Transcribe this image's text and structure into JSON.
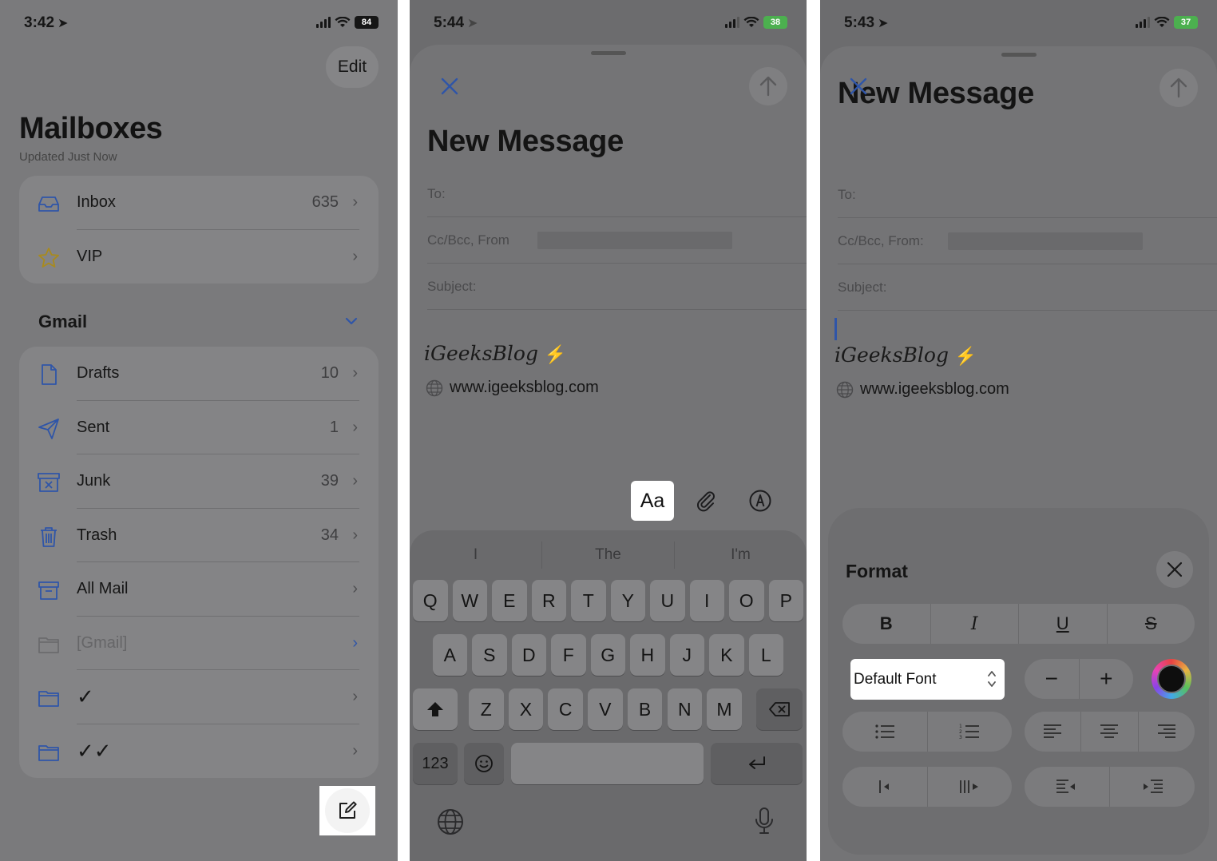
{
  "panel1": {
    "status": {
      "time": "3:42",
      "battery": "84",
      "battery_color": "#161616"
    },
    "edit_label": "Edit",
    "title": "Mailboxes",
    "subtitle": "Updated Just Now",
    "top_items": [
      {
        "label": "Inbox",
        "count": "635",
        "icon": "inbox-icon"
      },
      {
        "label": "VIP",
        "count": "",
        "icon": "star-icon"
      }
    ],
    "section": "Gmail",
    "gmail_items": [
      {
        "label": "Drafts",
        "count": "10",
        "icon": "document-icon"
      },
      {
        "label": "Sent",
        "count": "1",
        "icon": "paper-plane-icon"
      },
      {
        "label": "Junk",
        "count": "39",
        "icon": "junk-box-icon"
      },
      {
        "label": "Trash",
        "count": "34",
        "icon": "trash-icon"
      },
      {
        "label": "All Mail",
        "count": "",
        "icon": "archive-box-icon"
      },
      {
        "label": "[Gmail]",
        "count": "",
        "icon": "folder-icon"
      },
      {
        "label": "✓",
        "count": "",
        "icon": "folder-icon"
      },
      {
        "label": "✓✓",
        "count": "",
        "icon": "folder-icon"
      }
    ],
    "compose_icon": "compose-icon"
  },
  "panel2": {
    "status": {
      "time": "5:44",
      "battery": "38",
      "battery_color": "#4cb04f"
    },
    "title": "New Message",
    "to_label": "To:",
    "ccbcc_label": "Cc/Bcc, From",
    "subject_label": "Subject:",
    "signature": "iGeeksBlog",
    "url": "www.igeeksblog.com",
    "aa_label": "Aa",
    "suggestions": [
      "I",
      "The",
      "I'm"
    ],
    "keys_row1": [
      "Q",
      "W",
      "E",
      "R",
      "T",
      "Y",
      "U",
      "I",
      "O",
      "P"
    ],
    "keys_row2": [
      "A",
      "S",
      "D",
      "F",
      "G",
      "H",
      "J",
      "K",
      "L"
    ],
    "keys_row3": [
      "Z",
      "X",
      "C",
      "V",
      "B",
      "N",
      "M"
    ],
    "numbers_label": "123"
  },
  "panel3": {
    "status": {
      "time": "5:43",
      "battery": "37",
      "battery_color": "#4cb04f"
    },
    "title": "New Message",
    "to_label": "To:",
    "ccbcc_label": "Cc/Bcc, From:",
    "subject_label": "Subject:",
    "signature": "iGeeksBlog",
    "url": "www.igeeksblog.com",
    "format_title": "Format",
    "style_buttons": [
      "B",
      "I",
      "U",
      "S"
    ],
    "font_value": "Default Font",
    "minus_label": "−",
    "plus_label": "+"
  }
}
